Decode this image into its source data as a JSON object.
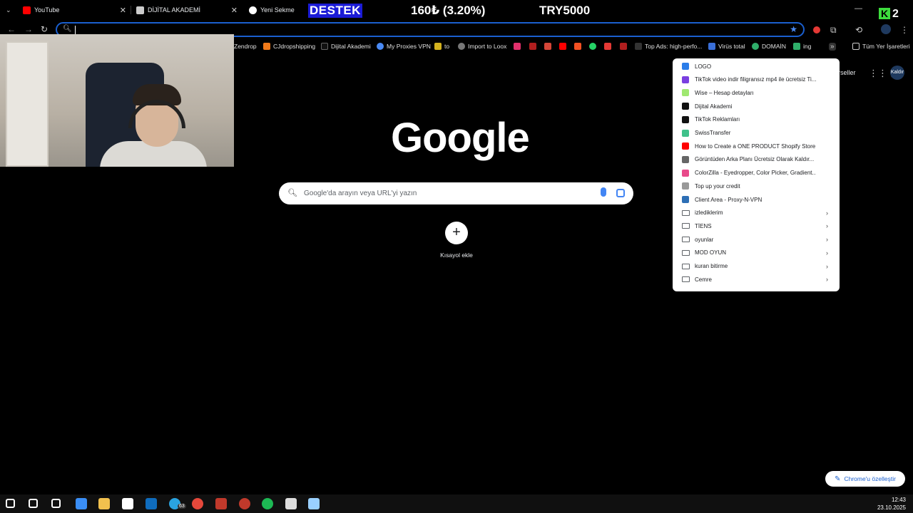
{
  "tabs": [
    {
      "label": "YouTube",
      "color": "#ff0000"
    },
    {
      "label": "DİJİTAL AKADEMİ",
      "color": "#cccccc"
    },
    {
      "label": "Yeni Sekme",
      "color": "#ffffff"
    }
  ],
  "overlay": {
    "label1": "DESTEK",
    "label2": "160₺ (3.20%)",
    "label3": "TRY5000",
    "badge": "2"
  },
  "toolbar": {
    "search_icon": "search-icon",
    "star_icon": "star-icon"
  },
  "bookmarks": [
    {
      "label": "Zendrop",
      "color": "#000000"
    },
    {
      "label": "CJdropshipping",
      "color": "#f07a1a"
    },
    {
      "label": "Dijital Akademi",
      "color": "#111111"
    },
    {
      "label": "My Proxies VPN",
      "color": "#4a8af4"
    },
    {
      "label": "to",
      "color": "#d4b21e"
    },
    {
      "label": "Import to Loox",
      "color": "#777777"
    },
    {
      "label": "Top Ads: high-perfo...",
      "color": "#333333"
    },
    {
      "label": "Virüs total",
      "color": "#3a6fd8"
    },
    {
      "label": "DOMAİN",
      "color": "#2fae6a"
    },
    {
      "label": "ing",
      "color": "#2fae6a"
    },
    {
      "label": "Tüm Yer İşaretleri",
      "color": "#cccccc"
    }
  ],
  "ntp": {
    "logo": "Google",
    "search_placeholder": "Google'da arayın veya URL'yi yazın",
    "add_shortcut_label": "Kısayol ekle",
    "topright_link": "orseller",
    "profile": "Kaldır",
    "customize_label": "Chrome'u özelleştir"
  },
  "menu": {
    "items": [
      {
        "label": "LOGO",
        "type": "link",
        "color": "#2b7de9"
      },
      {
        "label": "TikTok video indir filigransız mp4 ile ücretsiz Ti...",
        "type": "link",
        "color": "#7a3fe0"
      },
      {
        "label": "Wise – Hesap detayları",
        "type": "link",
        "color": "#9fe870"
      },
      {
        "label": "Dijital Akademi",
        "type": "link",
        "color": "#111111"
      },
      {
        "label": "TikTok Reklamları",
        "type": "link",
        "color": "#111111"
      },
      {
        "label": "SwissTransfer",
        "type": "link",
        "color": "#3fc18a"
      },
      {
        "label": "How to Create a ONE PRODUCT Shopify Store...",
        "type": "link",
        "color": "#ff0000"
      },
      {
        "label": "Görüntüden Arka Planı Ücretsiz Olarak Kaldır...",
        "type": "link",
        "color": "#666666"
      },
      {
        "label": "ColorZilla - Eyedropper, Color Picker, Gradient...",
        "type": "link",
        "color": "#e84a8a"
      },
      {
        "label": "Top up your credit",
        "type": "link",
        "color": "#999999"
      },
      {
        "label": "Client Area - Proxy-N-VPN",
        "type": "link",
        "color": "#2d6fb5"
      },
      {
        "label": "izlediklerim",
        "type": "folder"
      },
      {
        "label": "TİENS",
        "type": "folder"
      },
      {
        "label": "oyunlar",
        "type": "folder"
      },
      {
        "label": "MOD OYUN",
        "type": "folder"
      },
      {
        "label": "kuran bitirme",
        "type": "folder"
      },
      {
        "label": "Cemre",
        "type": "folder"
      }
    ]
  },
  "taskbar": {
    "time": "12:43",
    "date": "23.10.2025",
    "telegram_badge": "63",
    "icons": [
      {
        "name": "windows-start-icon",
        "color": "#ffffff"
      },
      {
        "name": "search-icon",
        "color": "#ffffff"
      },
      {
        "name": "task-view-icon",
        "color": "#ffffff"
      },
      {
        "name": "copilot-icon",
        "color": "#3a8ef6"
      },
      {
        "name": "file-explorer-icon",
        "color": "#f2c14e"
      },
      {
        "name": "store-icon",
        "color": "#ffffff"
      },
      {
        "name": "outlook-icon",
        "color": "#0f6cbd"
      },
      {
        "name": "telegram-icon",
        "color": "#2aa3e0"
      },
      {
        "name": "chrome-icon",
        "color": "#e5483b"
      },
      {
        "name": "voicemeeter-icon",
        "color": "#c0392b"
      },
      {
        "name": "obs-icon",
        "color": "#c0392b"
      },
      {
        "name": "spotify-icon",
        "color": "#1db954"
      },
      {
        "name": "capture-icon",
        "color": "#dddddd"
      },
      {
        "name": "app-icon",
        "color": "#9ad0ff"
      }
    ]
  }
}
